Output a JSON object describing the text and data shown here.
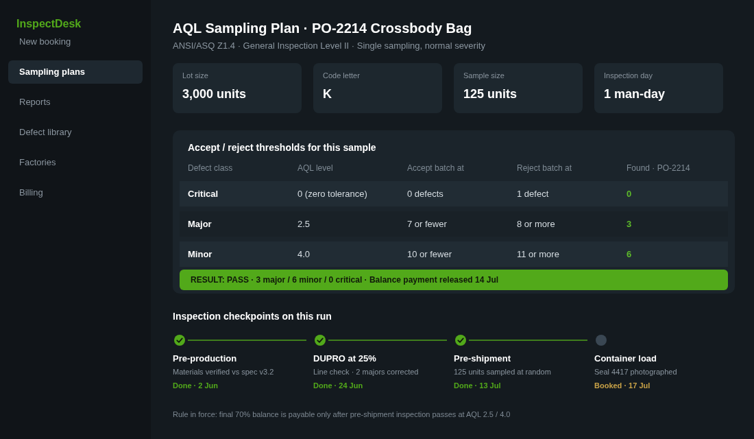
{
  "sidebar": {
    "brand": "InspectDesk",
    "items": [
      {
        "label": "New booking",
        "selected": false
      },
      {
        "label": "Sampling plans",
        "selected": true
      },
      {
        "label": "Reports",
        "selected": false
      },
      {
        "label": "Defect library",
        "selected": false
      },
      {
        "label": "Factories",
        "selected": false
      },
      {
        "label": "Billing",
        "selected": false
      }
    ]
  },
  "header": {
    "title": "AQL Sampling Plan · PO-2214 Crossbody Bag",
    "subtitle": "ANSI/ASQ Z1.4 · General Inspection Level II · Single sampling, normal severity"
  },
  "stats": [
    {
      "label": "Lot size",
      "value": "3,000 units"
    },
    {
      "label": "Code letter",
      "value": "K"
    },
    {
      "label": "Sample size",
      "value": "125 units"
    },
    {
      "label": "Inspection day",
      "value": "1 man-day"
    }
  ],
  "thresholds": {
    "title": "Accept / reject thresholds for this sample",
    "columns": [
      "Defect class",
      "AQL level",
      "Accept batch at",
      "Reject batch at",
      "Found · PO-2214"
    ],
    "rows": [
      {
        "defect_class": "Critical",
        "aql_level": "0 (zero tolerance)",
        "accept": "0 defects",
        "reject": "1 defect",
        "found": "0",
        "within_limit": true
      },
      {
        "defect_class": "Major",
        "aql_level": "2.5",
        "accept": "7 or fewer",
        "reject": "8 or more",
        "found": "3",
        "within_limit": true
      },
      {
        "defect_class": "Minor",
        "aql_level": "4.0",
        "accept": "10 or fewer",
        "reject": "11 or more",
        "found": "6",
        "within_limit": true
      }
    ],
    "result": {
      "text": "RESULT: PASS · 3 major / 6 minor / 0 critical · Balance payment released 14 Jul",
      "passed": true
    }
  },
  "checkpoints": {
    "title": "Inspection checkpoints on this run",
    "steps": [
      {
        "name": "Pre-production",
        "detail": "Materials verified vs spec v3.2",
        "status": "Done · 2 Jun",
        "done": true
      },
      {
        "name": "DUPRO at 25%",
        "detail": "Line check · 2 majors corrected",
        "status": "Done · 24 Jun",
        "done": true
      },
      {
        "name": "Pre-shipment",
        "detail": "125 units sampled at random",
        "status": "Done · 13 Jul",
        "done": true
      },
      {
        "name": "Container load",
        "detail": "Seal 4417 photographed",
        "status": "Booked · 17 Jul",
        "done": false
      }
    ]
  },
  "footnote": "Rule in force: final 70% balance is payable only after pre-shipment inspection passes at AQL 2.5 / 4.0"
}
